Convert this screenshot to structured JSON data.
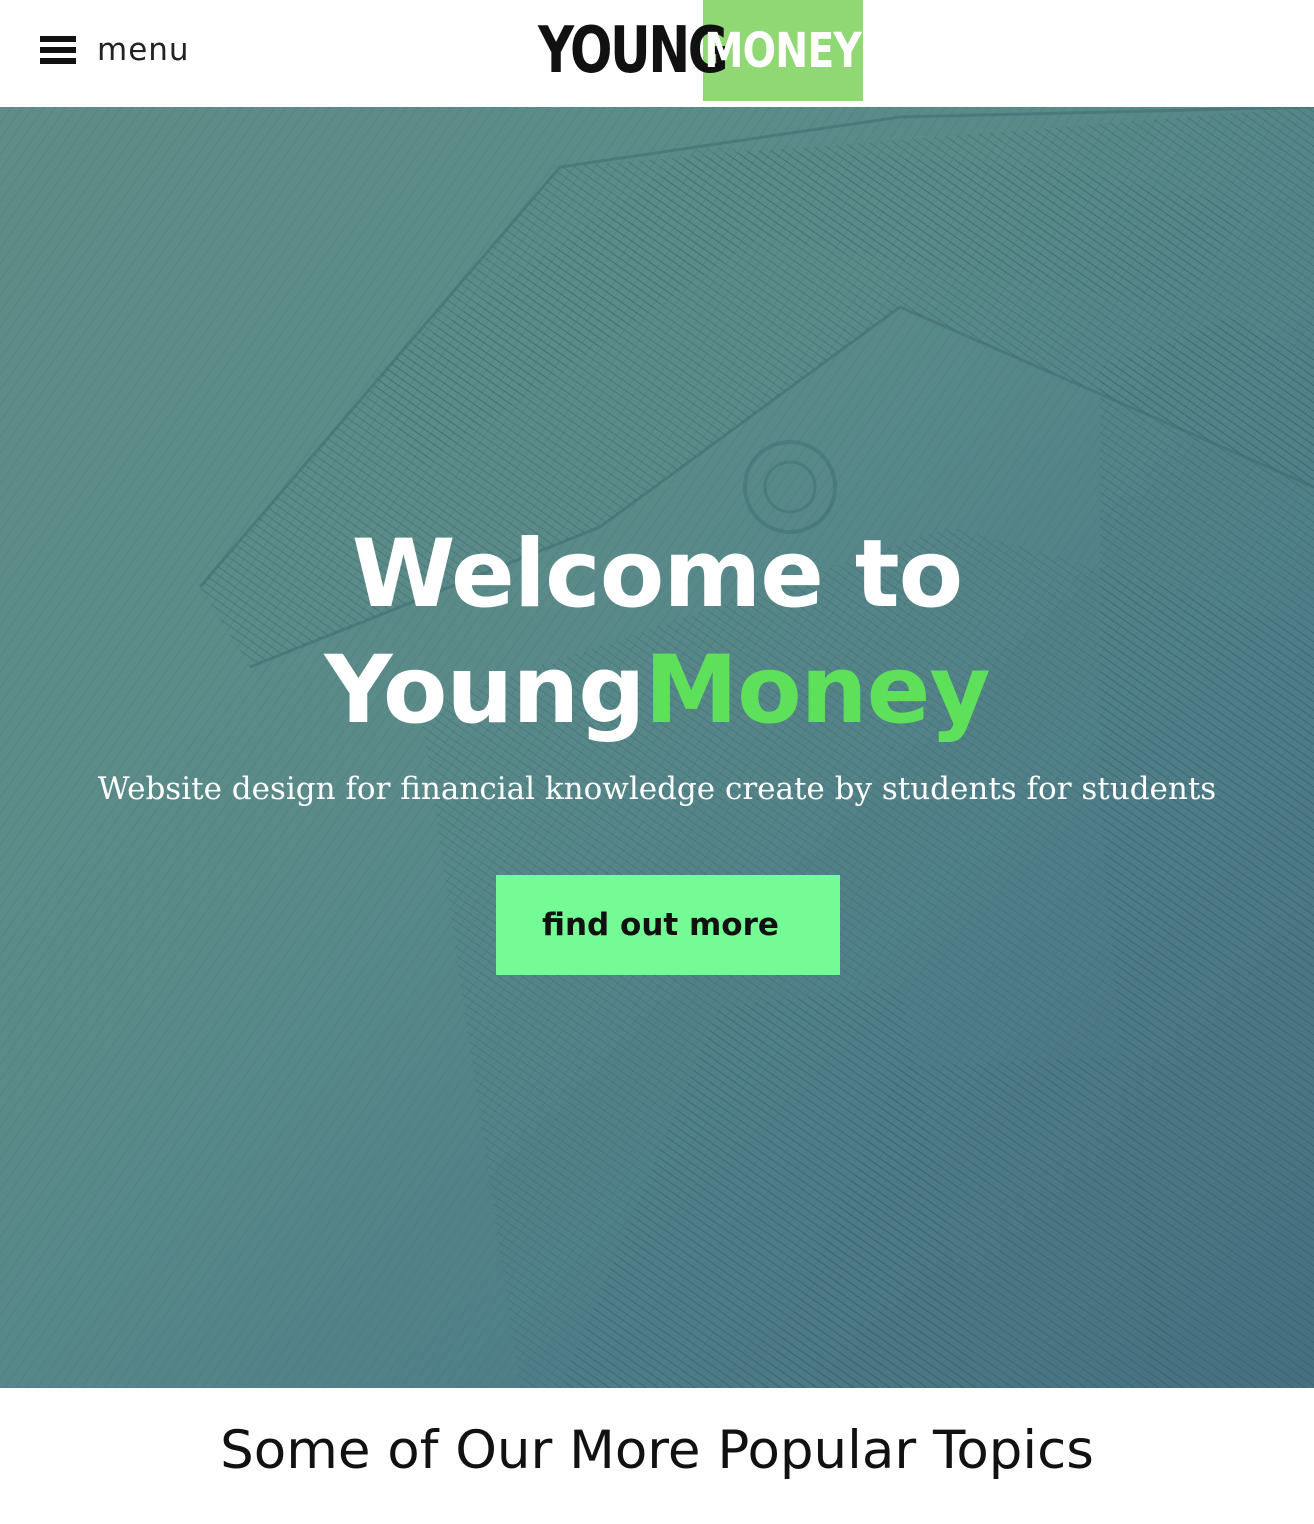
{
  "header": {
    "menu_label": "menu",
    "logo": {
      "part1": "YOUNG",
      "part2": "MONEY",
      "accent_color": "#8fd873"
    },
    "icons": {
      "menu": "hamburger-menu-icon"
    }
  },
  "hero": {
    "title_line1": "Welcome to",
    "title_part1": "Young",
    "title_part2": "Money",
    "subtitle": "Website design for financial knowledge create by students for students",
    "cta_label": "find out more",
    "accent_color": "#5fe05a",
    "button_color": "#74fb96",
    "overlay_color": "#5a8b89"
  },
  "topics": {
    "heading": "Some of Our More Popular Topics"
  }
}
